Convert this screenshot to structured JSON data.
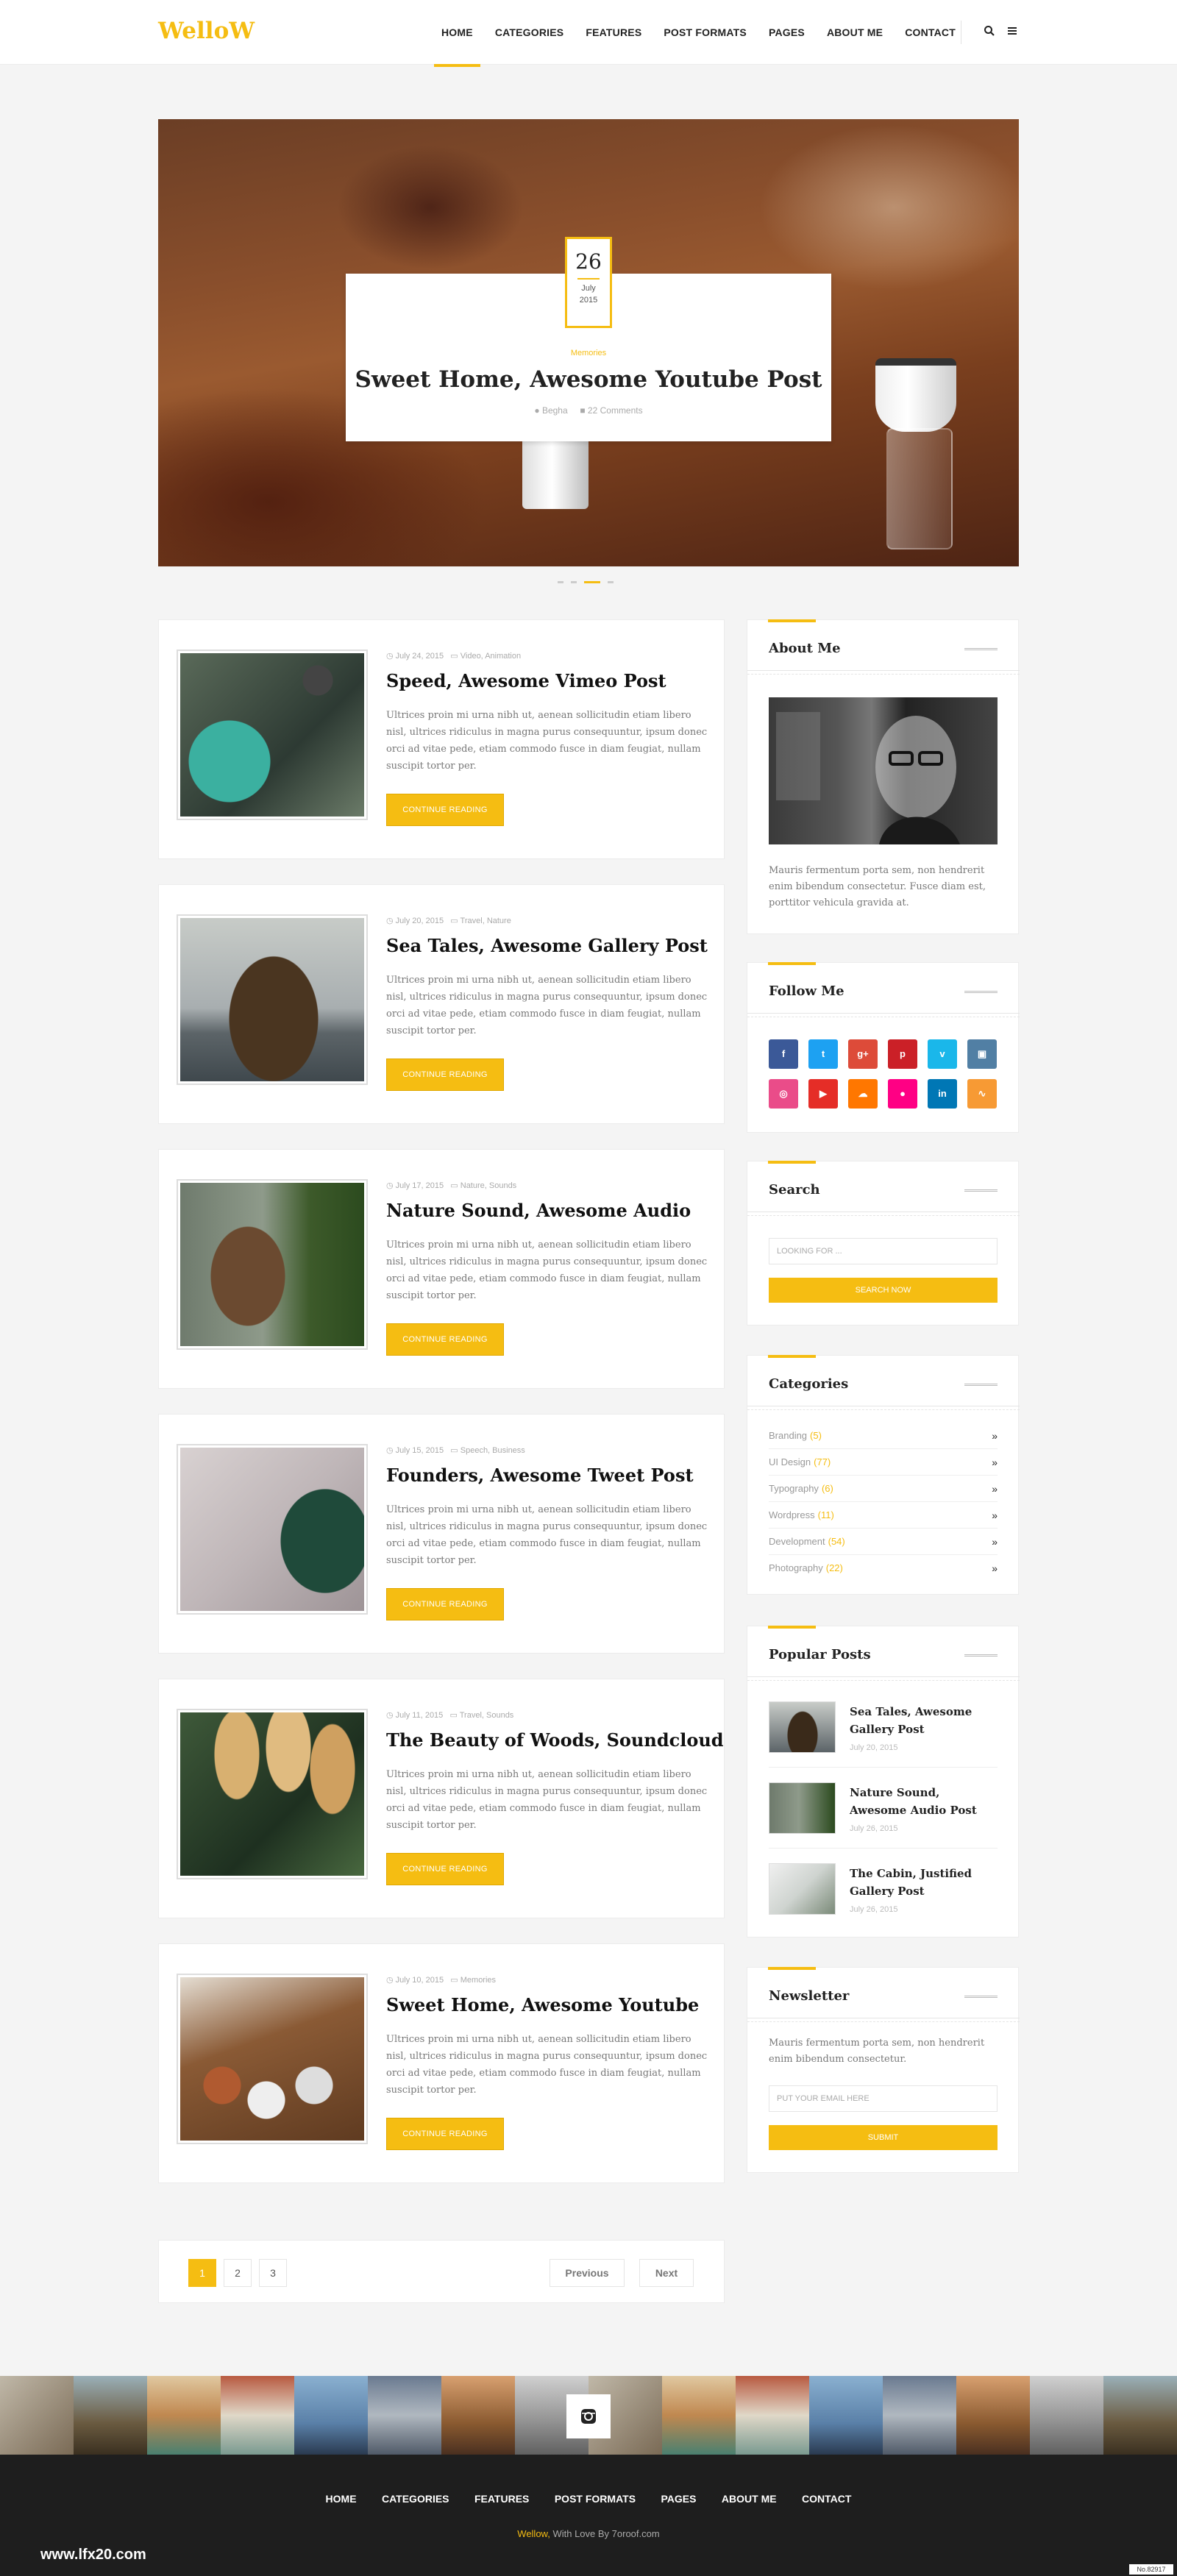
{
  "header": {
    "logo": "WelloW",
    "nav": [
      "HOME",
      "CATEGORIES",
      "FEATURES",
      "POST FORMATS",
      "PAGES",
      "ABOUT ME",
      "CONTACT"
    ],
    "icons": [
      "search-icon",
      "menu-icon"
    ]
  },
  "slider": {
    "day": "26",
    "month": "July",
    "year": "2015",
    "category": "Memories",
    "title": "Sweet Home, Awesome Youtube Post",
    "author": "Begha",
    "comments": "22 Comments"
  },
  "posts": [
    {
      "date": "July 24, 2015",
      "cats": "Video, Animation",
      "title": "Speed, Awesome Vimeo Post"
    },
    {
      "date": "July 20, 2015",
      "cats": "Travel, Nature",
      "title": "Sea Tales, Awesome Gallery Post"
    },
    {
      "date": "July 17, 2015",
      "cats": "Nature, Sounds",
      "title": "Nature Sound, Awesome Audio"
    },
    {
      "date": "July 15, 2015",
      "cats": "Speech, Business",
      "title": "Founders, Awesome Tweet Post"
    },
    {
      "date": "July 11, 2015",
      "cats": "Travel, Sounds",
      "title": "The Beauty of Woods, Soundcloud"
    },
    {
      "date": "July 10, 2015",
      "cats": "Memories",
      "title": "Sweet Home, Awesome Youtube"
    }
  ],
  "post_excerpt": "Ultrices proin mi urna nibh ut, aenean sollicitudin etiam libero nisl, ultrices ridiculus in magna purus consequuntur, ipsum donec orci ad vitae pede, etiam commodo fusce in diam feugiat, nullam suscipit tortor per.",
  "post_button": "CONTINUE READING",
  "pagination": {
    "pages": [
      "1",
      "2",
      "3"
    ],
    "prev": "Previous",
    "next": "Next"
  },
  "sidebar": {
    "about": {
      "title": "About Me",
      "text": "Mauris fermentum porta sem, non hendrerit enim bibendum consectetur. Fusce diam est, porttitor vehicula gravida at."
    },
    "follow": {
      "title": "Follow Me"
    },
    "search": {
      "title": "Search",
      "placeholder": "LOOKING FOR ...",
      "button": "SEARCH NOW"
    },
    "categories": {
      "title": "Categories",
      "items": [
        {
          "name": "Branding",
          "count": "(5)"
        },
        {
          "name": "UI Design",
          "count": "(77)"
        },
        {
          "name": "Typography",
          "count": "(6)"
        },
        {
          "name": "Wordpress",
          "count": "(11)"
        },
        {
          "name": "Development",
          "count": "(54)"
        },
        {
          "name": "Photography",
          "count": "(22)"
        }
      ]
    },
    "popular": {
      "title": "Popular Posts",
      "items": [
        {
          "title": "Sea Tales, Awesome Gallery Post",
          "date": "July 20, 2015"
        },
        {
          "title": "Nature Sound, Awesome Audio Post",
          "date": "July 26, 2015"
        },
        {
          "title": "The Cabin, Justified Gallery Post",
          "date": "July 26, 2015"
        }
      ]
    },
    "newsletter": {
      "title": "Newsletter",
      "text": "Mauris fermentum porta sem, non hendrerit enim bibendum consectetur.",
      "placeholder": "PUT YOUR EMAIL HERE",
      "button": "SUBMIT"
    }
  },
  "footer": {
    "nav": [
      "HOME",
      "CATEGORIES",
      "FEATURES",
      "POST FORMATS",
      "PAGES",
      "ABOUT ME",
      "CONTACT"
    ],
    "brand": "Wellow,",
    "copy": "With Love By 7oroof.com",
    "watermark": "www.lfx20.com",
    "tag": "No.82917"
  },
  "colors": {
    "accent": "#f5bd12",
    "footer_bg": "#1e1e1e"
  }
}
